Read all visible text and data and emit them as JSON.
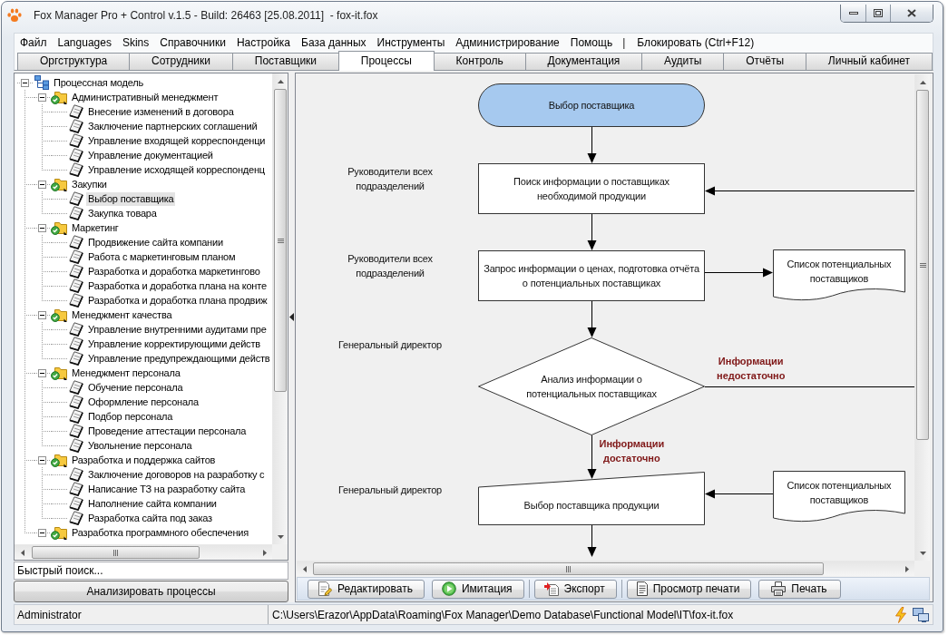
{
  "window": {
    "title": "Fox Manager Pro + Control v.1.5 - Build: 26463 [25.08.2011]  - fox-it.fox"
  },
  "menu": [
    {
      "kind": "item",
      "label": "Файл"
    },
    {
      "kind": "item",
      "label": "Languages"
    },
    {
      "kind": "item",
      "label": "Skins"
    },
    {
      "kind": "item",
      "label": "Справочники"
    },
    {
      "kind": "item",
      "label": "Настройка"
    },
    {
      "kind": "item",
      "label": "База данных"
    },
    {
      "kind": "item",
      "label": "Инструменты"
    },
    {
      "kind": "item",
      "label": "Администрирование"
    },
    {
      "kind": "item",
      "label": "Помощь"
    },
    {
      "kind": "separator",
      "label": "|"
    },
    {
      "kind": "item",
      "label": "Блокировать (Ctrl+F12)"
    }
  ],
  "tabs": [
    {
      "label": "Оргструктура",
      "selected": false
    },
    {
      "label": "Сотрудники",
      "selected": false
    },
    {
      "label": "Поставщики",
      "selected": false
    },
    {
      "label": "Процессы",
      "selected": true
    },
    {
      "label": "Контроль",
      "selected": false
    },
    {
      "label": "Документация",
      "selected": false
    },
    {
      "label": "Аудиты",
      "selected": false
    },
    {
      "label": "Отчёты",
      "selected": false
    },
    {
      "label": "Личный кабинет",
      "selected": false
    }
  ],
  "left_panel": {
    "tree": {
      "kind": "model",
      "label": "Процессная модель",
      "expanded": true,
      "selected": false,
      "children": [
        {
          "kind": "group",
          "label": "Административный менеджмент",
          "expanded": true,
          "selected": false,
          "children": [
            {
              "kind": "process",
              "label": "Внесение изменений в договора",
              "selected": false
            },
            {
              "kind": "process",
              "label": "Заключение партнерских соглашений",
              "selected": false
            },
            {
              "kind": "process",
              "label": "Управление входящей корреспонденци",
              "selected": false
            },
            {
              "kind": "process",
              "label": "Управление документацией",
              "selected": false
            },
            {
              "kind": "process",
              "label": "Управление исходящей корреспонденц",
              "selected": false
            }
          ]
        },
        {
          "kind": "group",
          "label": "Закупки",
          "expanded": true,
          "selected": false,
          "children": [
            {
              "kind": "process",
              "label": "Выбор поставщика",
              "selected": true
            },
            {
              "kind": "process",
              "label": "Закупка товара",
              "selected": false
            }
          ]
        },
        {
          "kind": "group",
          "label": "Маркетинг",
          "expanded": true,
          "selected": false,
          "children": [
            {
              "kind": "process",
              "label": "Продвижение сайта компании",
              "selected": false
            },
            {
              "kind": "process",
              "label": "Работа с маркетинговым планом",
              "selected": false
            },
            {
              "kind": "process",
              "label": "Разработка и доработка маркетингово",
              "selected": false
            },
            {
              "kind": "process",
              "label": "Разработка и доработка плана на конте",
              "selected": false
            },
            {
              "kind": "process",
              "label": "Разработка и доработка плана продвиж",
              "selected": false
            }
          ]
        },
        {
          "kind": "group",
          "label": "Менеджмент качества",
          "expanded": true,
          "selected": false,
          "children": [
            {
              "kind": "process",
              "label": "Управление внутренними аудитами пре",
              "selected": false
            },
            {
              "kind": "process",
              "label": "Управление корректирующими действ",
              "selected": false
            },
            {
              "kind": "process",
              "label": "Управление предупреждающими действ",
              "selected": false
            }
          ]
        },
        {
          "kind": "group",
          "label": "Менеджмент персонала",
          "expanded": true,
          "selected": false,
          "children": [
            {
              "kind": "process",
              "label": "Обучение персонала",
              "selected": false
            },
            {
              "kind": "process",
              "label": "Оформление персонала",
              "selected": false
            },
            {
              "kind": "process",
              "label": "Подбор персонала",
              "selected": false
            },
            {
              "kind": "process",
              "label": "Проведение аттестации персонала",
              "selected": false
            },
            {
              "kind": "process",
              "label": "Увольнение персонала",
              "selected": false
            }
          ]
        },
        {
          "kind": "group",
          "label": "Разработка и поддержка сайтов",
          "expanded": true,
          "selected": false,
          "children": [
            {
              "kind": "process",
              "label": "Заключение договоров на разработку с",
              "selected": false
            },
            {
              "kind": "process",
              "label": "Написание ТЗ на разработку сайта",
              "selected": false
            },
            {
              "kind": "process",
              "label": "Наполнение сайта компании",
              "selected": false
            },
            {
              "kind": "process",
              "label": "Разработка сайта под заказ",
              "selected": false
            }
          ]
        },
        {
          "kind": "group",
          "label": "Разработка программного обеспечения",
          "expanded": true,
          "selected": false
        }
      ]
    },
    "search": {
      "placeholder": "Быстрый поиск..."
    },
    "analyze_button": "Анализировать процессы"
  },
  "right_panel": {
    "diagram": {
      "steps": [
        {
          "kind": "terminal",
          "text": "Выбор поставщика"
        },
        {
          "kind": "process",
          "role": "Руководители всех\nподразделений",
          "text": "Поиск информации о поставщиках\nнеобходимой продукции",
          "loop_in": true
        },
        {
          "kind": "process",
          "role": "Руководители всех\nподразделений",
          "text": "Запрос информации о ценах, подготовка отчёта\nо потенциальных поставщиках",
          "output_document": "Список потенциальных\nпоставщиков"
        },
        {
          "kind": "decision",
          "role": "Генеральный директор",
          "text": "Анализ информации о\nпотенциальных поставщиках",
          "loop_label": "Информации\nнедостаточно",
          "next_label": "Информации\nдостаточно"
        },
        {
          "kind": "manual_input",
          "role": "Генеральный директор",
          "text": "Выбор поставщика продукции",
          "input_document": "Список потенциальных\nпоставщиков"
        }
      ],
      "continues_below": true
    },
    "toolbar": {
      "groups": [
        [
          "Редактировать",
          "Имитация"
        ],
        [
          "Экспорт"
        ],
        [
          "Просмотр печати",
          "Печать"
        ]
      ]
    }
  },
  "status_bar": {
    "user": "Administrator",
    "path": "C:\\Users\\Erazor\\AppData\\Roaming\\Fox Manager\\Demo Database\\Functional Model\\IT\\fox-it.fox"
  }
}
